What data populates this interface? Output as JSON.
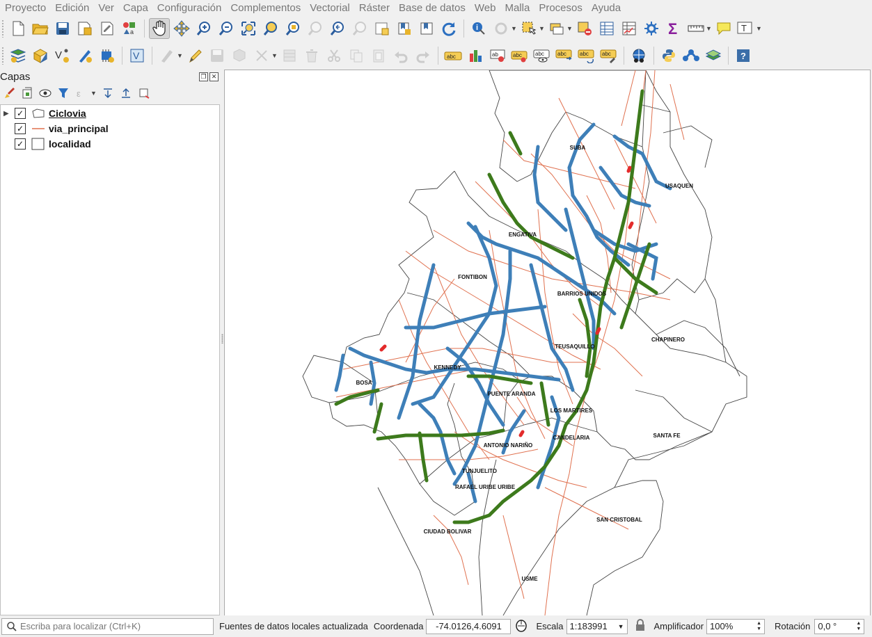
{
  "menu": [
    "Proyecto",
    "Edición",
    "Ver",
    "Capa",
    "Configuración",
    "Complementos",
    "Vectorial",
    "Ráster",
    "Base de datos",
    "Web",
    "Malla",
    "Procesos",
    "Ayuda"
  ],
  "colors": {
    "ciclovia_blue": "#3e7fb8",
    "ciclovia_green": "#3d7a1c",
    "via_red": "#e0714f",
    "boundary": "#444444",
    "hazard": "#e32b2b"
  },
  "layers_panel": {
    "title": "Capas",
    "float_symbol": "❐",
    "close_symbol": "✕"
  },
  "layers": [
    {
      "name": "Ciclovia",
      "checked": "✓",
      "expander": "▶",
      "icon": "polygon-layer-icon",
      "active": true
    },
    {
      "name": "via_principal",
      "checked": "✓",
      "expander": "",
      "icon": "line-layer-icon",
      "active": false
    },
    {
      "name": "localidad",
      "checked": "✓",
      "expander": "",
      "icon": "polygon-empty-icon",
      "active": false
    }
  ],
  "map_labels": [
    "SUBA",
    "USAQUEN",
    "ENGATIVA",
    "FONTIBON",
    "BARRIOS UNIDOS",
    "CHAPINERO",
    "TEUSAQUILLO",
    "KENNEDY",
    "BOSA",
    "PUENTE ARANDA",
    "LOS MARTIRES",
    "SANTA FE",
    "CANDELARIA",
    "ANTONIO NARIÑO",
    "TUNJUELITO",
    "RAFAEL URIBE URIBE",
    "SAN CRISTOBAL",
    "CIUDAD BOLIVAR",
    "USME"
  ],
  "status": {
    "search_placeholder": "Escriba para localizar (Ctrl+K)",
    "message": "Fuentes de datos locales actualizada",
    "coord_label": "Coordenada",
    "coord_value": "-74.0126,4.6091",
    "scale_label": "Escala",
    "scale_value": "1:183991",
    "magnifier_label": "Amplificador",
    "magnifier_value": "100%",
    "rotation_label": "Rotación",
    "rotation_value": "0,0 °"
  },
  "toolbar_labels": {
    "abc": "abc",
    "ab": "ab",
    "help": "?"
  }
}
